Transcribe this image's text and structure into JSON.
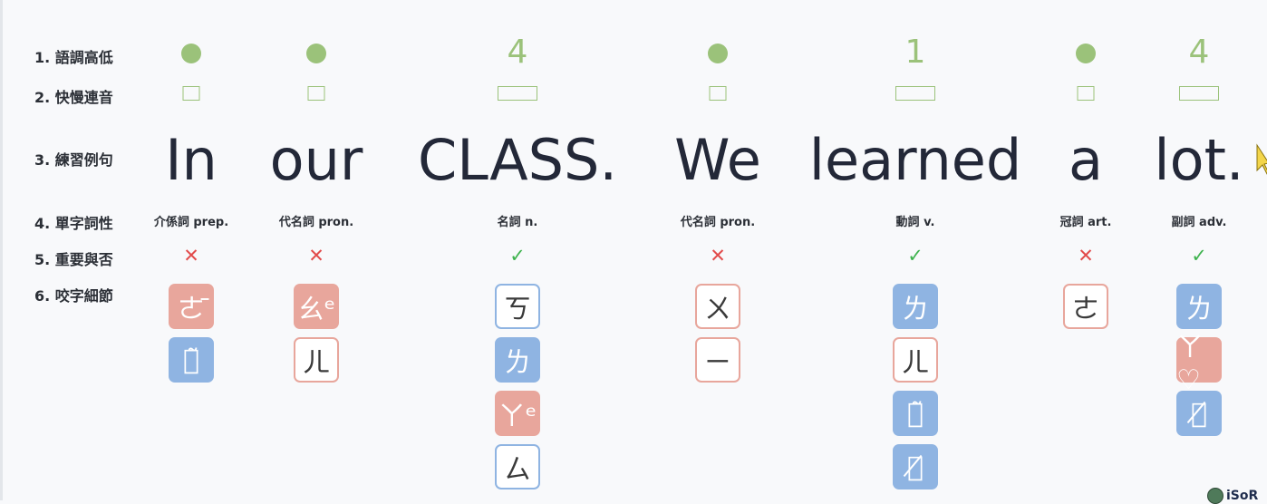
{
  "row_labels": [
    "1. 語調高低",
    "2. 快慢連音",
    "3. 練習例句",
    "4. 單字詞性",
    "5. 重要與否",
    "6. 咬字細節"
  ],
  "words": [
    {
      "text": "In",
      "tone": "dot",
      "speed": "short",
      "pos": "介係詞 prep.",
      "important": "✕",
      "phonetics": [
        {
          "sym": "ㄜ̄",
          "style": "pink"
        },
        {
          "sym": "ㄋ̃",
          "style": "blue"
        }
      ]
    },
    {
      "text": "our",
      "tone": "dot",
      "speed": "short",
      "pos": "代名詞 pron.",
      "important": "✕",
      "phonetics": [
        {
          "sym": "ㄠᵉ",
          "style": "pink"
        },
        {
          "sym": "ㄦ",
          "style": "out-pink"
        }
      ]
    },
    {
      "text": "CLASS.",
      "tone": "4",
      "speed": "long",
      "pos": "名詞 n.",
      "important": "✓",
      "phonetics": [
        {
          "sym": "ㄎ",
          "style": "out-blue"
        },
        {
          "sym": "ㄌ",
          "style": "blue"
        },
        {
          "sym": "ㄚᵉ",
          "style": "pink"
        },
        {
          "sym": "ㄙ",
          "style": "out-blue"
        }
      ]
    },
    {
      "text": "We",
      "tone": "dot",
      "speed": "short",
      "pos": "代名詞 pron.",
      "important": "✕",
      "phonetics": [
        {
          "sym": "ㄨ",
          "style": "out-pink"
        },
        {
          "sym": "ㄧ",
          "style": "out-pink"
        }
      ]
    },
    {
      "text": "learned",
      "tone": "1",
      "speed": "long",
      "pos": "動詞 v.",
      "important": "✓",
      "phonetics": [
        {
          "sym": "ㄌ",
          "style": "blue"
        },
        {
          "sym": "ㄦ",
          "style": "out-pink"
        },
        {
          "sym": "ㄋ̃",
          "style": "blue"
        },
        {
          "sym": "ㄉ̸",
          "style": "blue"
        }
      ]
    },
    {
      "text": "a",
      "tone": "dot",
      "speed": "short",
      "pos": "冠詞 art.",
      "important": "✕",
      "phonetics": [
        {
          "sym": "ㄜ",
          "style": "out-pink"
        }
      ]
    },
    {
      "text": "lot.",
      "tone": "4",
      "speed": "long",
      "pos": "副詞 adv.",
      "important": "✓",
      "phonetics": [
        {
          "sym": "ㄌ",
          "style": "blue"
        },
        {
          "sym": "ㄚ♡",
          "style": "pink"
        },
        {
          "sym": "ㄊ̸",
          "style": "blue"
        }
      ]
    }
  ],
  "logo": {
    "text": "iSoR"
  },
  "colors": {
    "tone_green": "#9bc27a",
    "cross_red": "#e24b4b",
    "check_green": "#3fb34f",
    "pink": "#e8a69c",
    "blue": "#8fb4e2"
  }
}
